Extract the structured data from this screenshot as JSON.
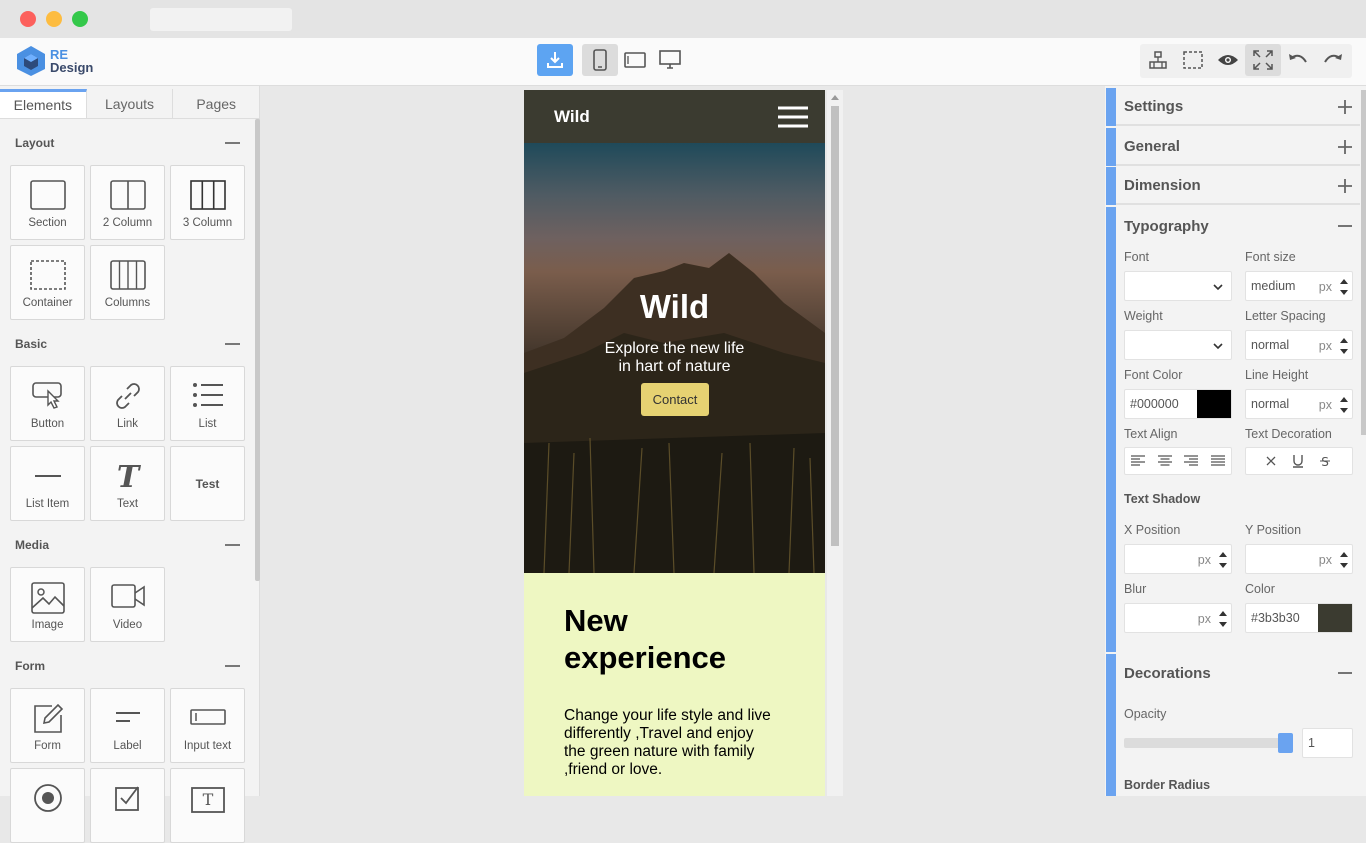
{
  "logo": {
    "line1": "RE",
    "line2": "Design"
  },
  "toolbar": {
    "download": "download-icon",
    "mobile": "mobile-icon",
    "tablet": "tablet-icon",
    "desktop": "desktop-icon"
  },
  "right_toolbar": [
    "sitemap-icon",
    "select-icon",
    "preview-icon",
    "fullscreen-icon",
    "undo-icon",
    "redo-icon"
  ],
  "tabs": [
    {
      "label": "Elements"
    },
    {
      "label": "Layouts"
    },
    {
      "label": "Pages"
    }
  ],
  "categories": {
    "layout": {
      "title": "Layout",
      "items": [
        "Section",
        "2 Column",
        "3 Column",
        "Container",
        "Columns"
      ]
    },
    "basic": {
      "title": "Basic",
      "items": [
        "Button",
        "Link",
        "List",
        "List Item",
        "Text",
        "Test"
      ]
    },
    "media": {
      "title": "Media",
      "items": [
        "Image",
        "Video"
      ]
    },
    "form": {
      "title": "Form",
      "items": [
        "Form",
        "Label",
        "Input text"
      ]
    }
  },
  "site": {
    "brand": "Wild",
    "hero_title": "Wild",
    "hero_sub1": "Explore the new life",
    "hero_sub2": "in hart of nature",
    "cta": "Contact",
    "h2_line1": "New",
    "h2_line2": "experience",
    "body1": "Change your life style and live",
    "body2": "differently ,Travel and enjoy",
    "body3": "the green nature with family",
    "body4": ",friend or love."
  },
  "panel": {
    "settings": "Settings",
    "general": "General",
    "dimension": "Dimension",
    "typography": "Typography",
    "font": "Font",
    "font_size": "Font size",
    "font_size_val": "medium",
    "unit": "px",
    "weight": "Weight",
    "letter_spacing": "Letter Spacing",
    "letter_spacing_val": "normal",
    "font_color": "Font Color",
    "font_color_val": "#000000",
    "line_height": "Line Height",
    "line_height_val": "normal",
    "text_align": "Text Align",
    "text_decoration": "Text Decoration",
    "text_shadow": "Text Shadow",
    "x_position": "X Position",
    "y_position": "Y Position",
    "blur": "Blur",
    "color": "Color",
    "shadow_color_val": "#3b3b30",
    "decorations": "Decorations",
    "opacity": "Opacity",
    "opacity_val": "1",
    "border_radius": "Border Radius"
  },
  "colors": {
    "accent": "#6aa3f0",
    "nav": "#3b3b30",
    "content_bg": "#eef7c2",
    "cta": "#e6d272"
  }
}
